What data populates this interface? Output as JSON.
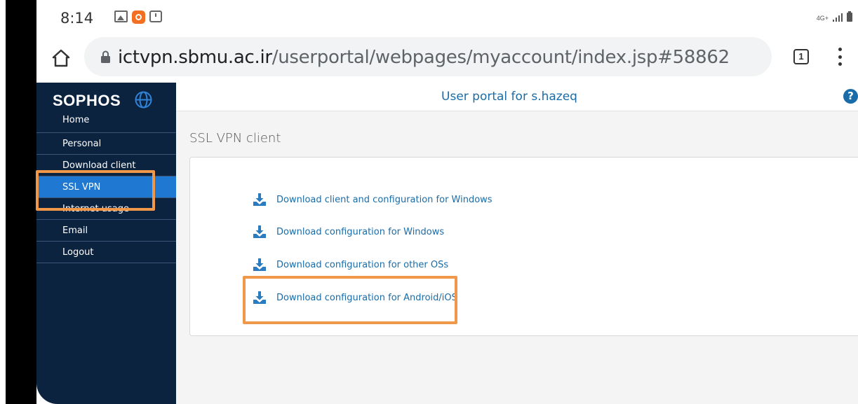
{
  "status_bar": {
    "time": "8:14",
    "network": "4G+"
  },
  "browser": {
    "url_host": "ictvpn.sbmu.ac.ir",
    "url_path": "/userportal/webpages/myaccount/index.jsp#58862",
    "tab_count": "1"
  },
  "sidebar": {
    "logo": "SOPHOS",
    "items": [
      {
        "label": "Home"
      },
      {
        "label": "Personal"
      },
      {
        "label": "Download client"
      },
      {
        "label": "SSL VPN"
      },
      {
        "label": "Internet usage"
      },
      {
        "label": "Email"
      },
      {
        "label": "Logout"
      }
    ]
  },
  "header": {
    "title": "User portal for s.hazeq",
    "help": "?"
  },
  "main": {
    "section_title": "SSL VPN client",
    "downloads": [
      {
        "label": "Download client and configuration for Windows"
      },
      {
        "label": "Download configuration for Windows"
      },
      {
        "label": "Download configuration for other OSs"
      },
      {
        "label": "Download configuration for Android/iOS"
      }
    ]
  },
  "colors": {
    "sidebar_bg": "#0c2340",
    "active_item": "#1f78d1",
    "link": "#1a6ca8",
    "highlight": "#f0974a"
  }
}
